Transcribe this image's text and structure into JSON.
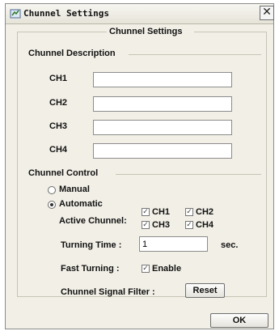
{
  "window": {
    "title": "Chunnel Settings",
    "close_glyph": "✕"
  },
  "group": {
    "title": "Chunnel Settings"
  },
  "description": {
    "title": "Chunnel Description",
    "channels": [
      {
        "label": "CH1",
        "value": ""
      },
      {
        "label": "CH2",
        "value": ""
      },
      {
        "label": "CH3",
        "value": ""
      },
      {
        "label": "CH4",
        "value": ""
      }
    ]
  },
  "control": {
    "title": "Chunnel Control",
    "manual_label": "Manual",
    "automatic_label": "Automatic",
    "mode_selected": "Automatic",
    "active_label": "Active  Chunnel:",
    "active_channels": [
      {
        "label": "CH1",
        "checked": true
      },
      {
        "label": "CH2",
        "checked": true
      },
      {
        "label": "CH3",
        "checked": true
      },
      {
        "label": "CH4",
        "checked": true
      }
    ],
    "turning_time_label": "Turning Time  :",
    "turning_time_value": "1",
    "turning_time_unit": "sec.",
    "fast_turning_label": "Fast Turning  :",
    "enable_label": "Enable",
    "enable_checked": true,
    "signal_filter_label": "Chunnel Signal Filter :",
    "reset_label": "Reset"
  },
  "ok_label": "OK",
  "icons": {
    "title": "settings-window-icon",
    "check": "check-icon",
    "close": "close-icon"
  }
}
